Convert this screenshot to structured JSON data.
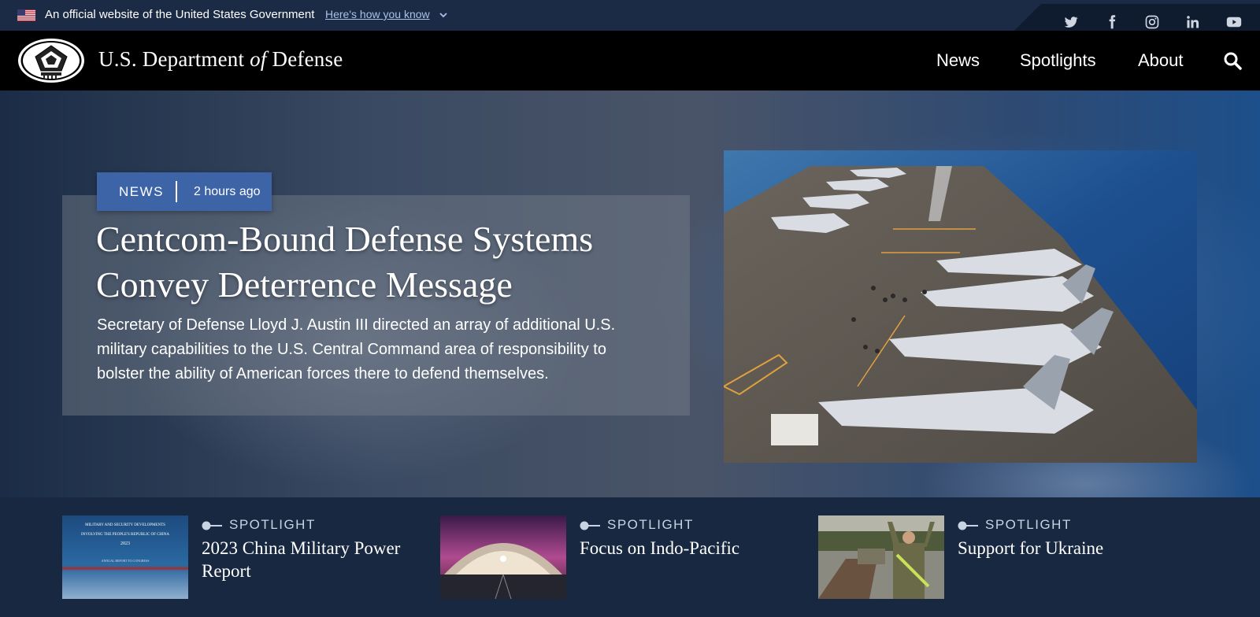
{
  "gov_banner": {
    "text": "An official website of the United States Government",
    "link": "Here's how you know"
  },
  "social": [
    "twitter-icon",
    "facebook-icon",
    "instagram-icon",
    "linkedin-icon",
    "youtube-icon"
  ],
  "header": {
    "title_part1": "U.S. Department ",
    "title_of": "of",
    "title_part2": " Defense",
    "nav": [
      "News",
      "Spotlights",
      "About"
    ]
  },
  "hero": {
    "badge_type": "NEWS",
    "badge_time": "2 hours ago",
    "headline": "Centcom-Bound Defense Systems Convey Deterrence Message",
    "summary": "Secretary of Defense Lloyd J. Austin III directed an array of additional U.S. military capabilities to the U.S. Central Command area of responsibility to bolster the ability of American forces there to defend themselves."
  },
  "spotlights": [
    {
      "label": "SPOTLIGHT",
      "title": "2023 China Military Power Report",
      "thumb_text": [
        "MILITARY AND SECURITY DEVELOPMENTS",
        "INVOLVING THE PEOPLE'S REPUBLIC OF CHINA",
        "2023",
        "ANNUAL REPORT TO CONGRESS"
      ]
    },
    {
      "label": "SPOTLIGHT",
      "title": "Focus on Indo-Pacific"
    },
    {
      "label": "SPOTLIGHT",
      "title": "Support for Ukraine"
    }
  ],
  "colors": {
    "badge": "#3d64a6",
    "header": "#000000",
    "banner": "#1b2b45",
    "spotlight_bg": "#172840"
  }
}
